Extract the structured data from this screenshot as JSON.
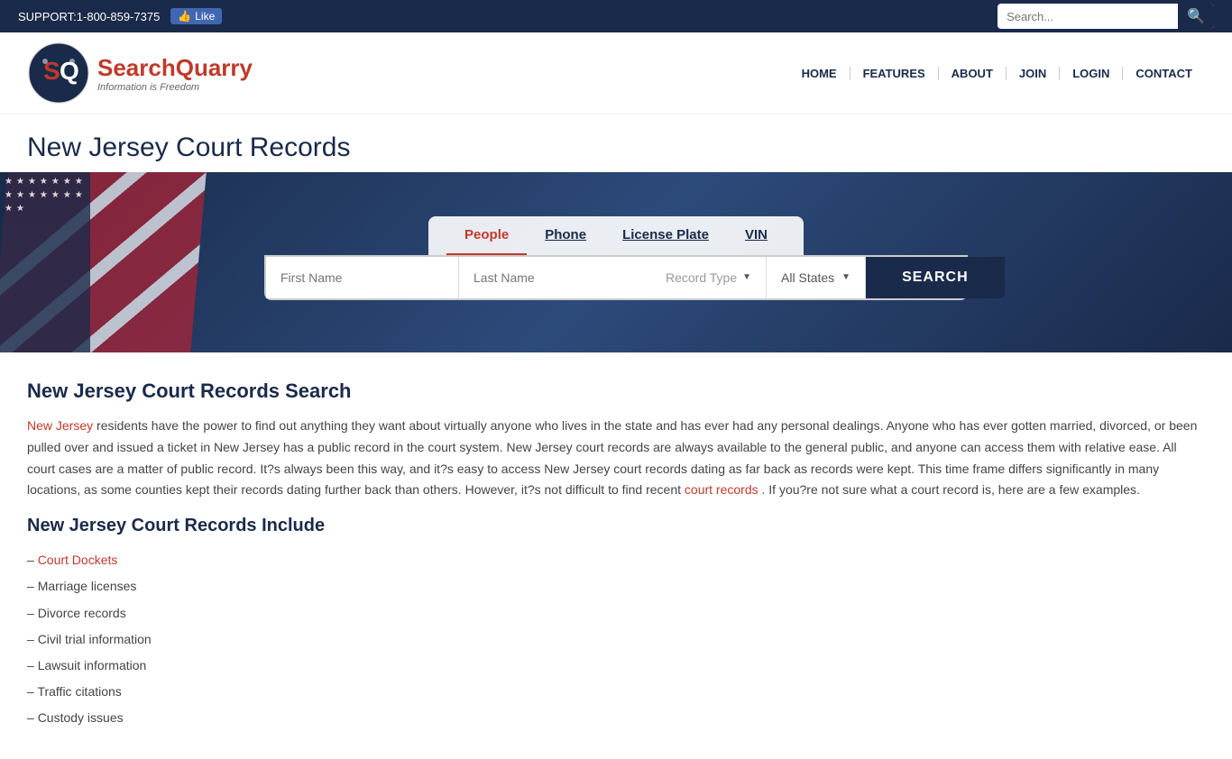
{
  "topbar": {
    "support": "SUPPORT:1-800-859-7375",
    "fb_like": "Like",
    "search_placeholder": "Search..."
  },
  "nav": {
    "logo_name": "SearchQuarry",
    "logo_tagline": "Information is Freedom",
    "links": [
      "HOME",
      "FEATURES",
      "ABOUT",
      "JOIN",
      "LOGIN",
      "CONTACT"
    ]
  },
  "page": {
    "title": "New Jersey Court Records"
  },
  "search": {
    "tabs": [
      {
        "label": "People",
        "active": true
      },
      {
        "label": "Phone",
        "active": false
      },
      {
        "label": "License Plate",
        "active": false
      },
      {
        "label": "VIN",
        "active": false
      }
    ],
    "first_name_placeholder": "First Name",
    "last_name_placeholder": "Last Name",
    "record_type_label": "Record Type",
    "all_states_label": "All States",
    "search_btn": "SEARCH"
  },
  "content": {
    "heading": "New Jersey Court Records Search",
    "nj_link": "New Jersey",
    "court_records_link": "court records",
    "paragraph": "residents have the power to find out anything they want about virtually anyone who lives in the state and has ever had any personal dealings. Anyone who has ever gotten married, divorced, or been pulled over and issued a ticket in New Jersey has a public record in the court system. New Jersey court records are always available to the general public, and anyone can access them with relative ease. All court cases are a matter of public record. It?s always been this way, and it?s easy to access New Jersey court records dating as far back as records were kept. This time frame differs significantly in many locations, as some counties kept their records dating further back than others. However, it?s not difficult to find recent",
    "paragraph_end": ". If you?re not sure what a court record is, here are a few examples.",
    "include_heading": "New Jersey Court Records Include",
    "records": [
      {
        "text": "Court Dockets",
        "link": true
      },
      {
        "text": "Marriage licenses",
        "link": false
      },
      {
        "text": "Divorce records",
        "link": false
      },
      {
        "text": "Civil trial information",
        "link": false
      },
      {
        "text": "Lawsuit information",
        "link": false
      },
      {
        "text": "Traffic citations",
        "link": false
      },
      {
        "text": "Custody issues",
        "link": false
      }
    ]
  }
}
